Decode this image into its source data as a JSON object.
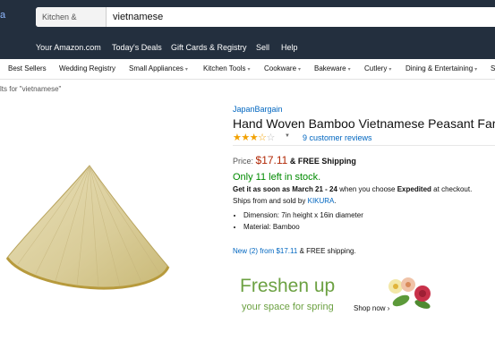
{
  "header": {
    "search": {
      "department": "Kitchen & Dining",
      "query": "vietnamese"
    }
  },
  "nav": {
    "items": [
      "Your Amazon.com",
      "Today's Deals",
      "Gift Cards & Registry",
      "Sell",
      "Help"
    ]
  },
  "categories": {
    "items": [
      "Best Sellers",
      "Wedding Registry",
      "Small Appliances",
      "Kitchen Tools",
      "Cookware",
      "Bakeware",
      "Cutlery",
      "Dining & Entertaining",
      "S"
    ]
  },
  "breadcrumb": "lts for \"vietnamese\"",
  "product": {
    "brand": "JapanBargain",
    "title": "Hand Woven Bamboo Vietnamese Peasant Far",
    "rating": 3.5,
    "reviews_text": "9 customer reviews",
    "price_label": "Price:",
    "price": "$17.11",
    "shipping": "& FREE Shipping",
    "stock": "Only 11 left in stock.",
    "arrival_prefix": "Get it as soon as",
    "arrival_date": "March 21 - 24",
    "arrival_middle": "when you choose",
    "arrival_option": "Expedited",
    "arrival_suffix": "at checkout.",
    "sold_prefix": "Ships from and sold by",
    "seller": "KIKURA",
    "sold_suffix": ".",
    "bullets": [
      "Dimension: 7in height x 16in diameter",
      "Material: Bamboo"
    ],
    "new_offers_link": "New (2) from $17.11",
    "new_offers_suffix": "& FREE shipping."
  },
  "ad": {
    "headline": "Freshen up",
    "subline": "your space for spring",
    "cta": "Shop now ›",
    "color": "#6ca142"
  },
  "colors": {
    "header_bg": "#232f3e",
    "link": "#0066c0",
    "price": "#b12704",
    "stock": "#008a00",
    "star": "#f2a100"
  }
}
